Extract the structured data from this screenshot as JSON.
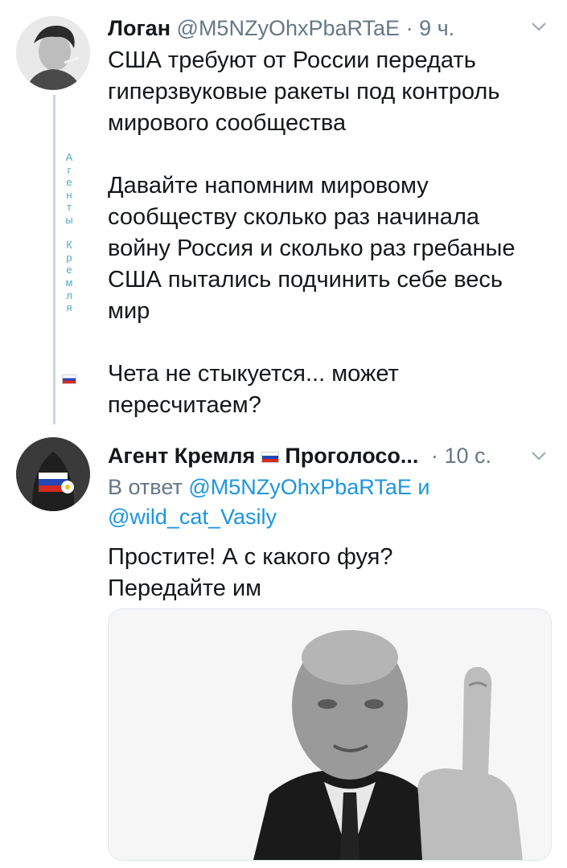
{
  "tweet1": {
    "name": "Логан",
    "handle": "@M5NZyOhxPbaRTaE",
    "separator": "·",
    "time": "9 ч.",
    "paragraph1": "США требуют от России передать гиперзвуковые ракеты под контроль мирового сообщества",
    "paragraph2": "Давайте напомним мировому сообществу сколько раз начинала войну Россия и сколько раз гребаные США пытались подчинить себе весь мир",
    "paragraph3": "Чета не стыкуется... может пересчитаем?",
    "chevron_icon": "chevron-down-icon",
    "avatar_icon": "user-avatar"
  },
  "vertical_caption": {
    "letters": [
      "А",
      "г",
      "е",
      "н",
      "т",
      "ы",
      "",
      "К",
      "р",
      "е",
      "м",
      "л",
      "я"
    ]
  },
  "tweet2": {
    "name": "Агент Кремля",
    "name_suffix": "Проголосо...",
    "separator": "·",
    "time": "10 с.",
    "reply_prefix": "В ответ",
    "reply_mention1": "@M5NZyOhxPbaRTaE",
    "reply_and": "и",
    "reply_mention2": "@wild_cat_Vasily",
    "line1": "Простите! А с какого фуя?",
    "line2": "Передайте им",
    "chevron_icon": "chevron-down-icon",
    "flag_icon": "russia-flag-icon",
    "media_icon": "photo-icon"
  },
  "colors": {
    "link": "#1b95e0",
    "secondary": "#657786",
    "thread_line": "#ccd6dd",
    "flag_white": "#ffffff",
    "flag_blue": "#2447b5",
    "flag_red": "#d52b1e"
  }
}
